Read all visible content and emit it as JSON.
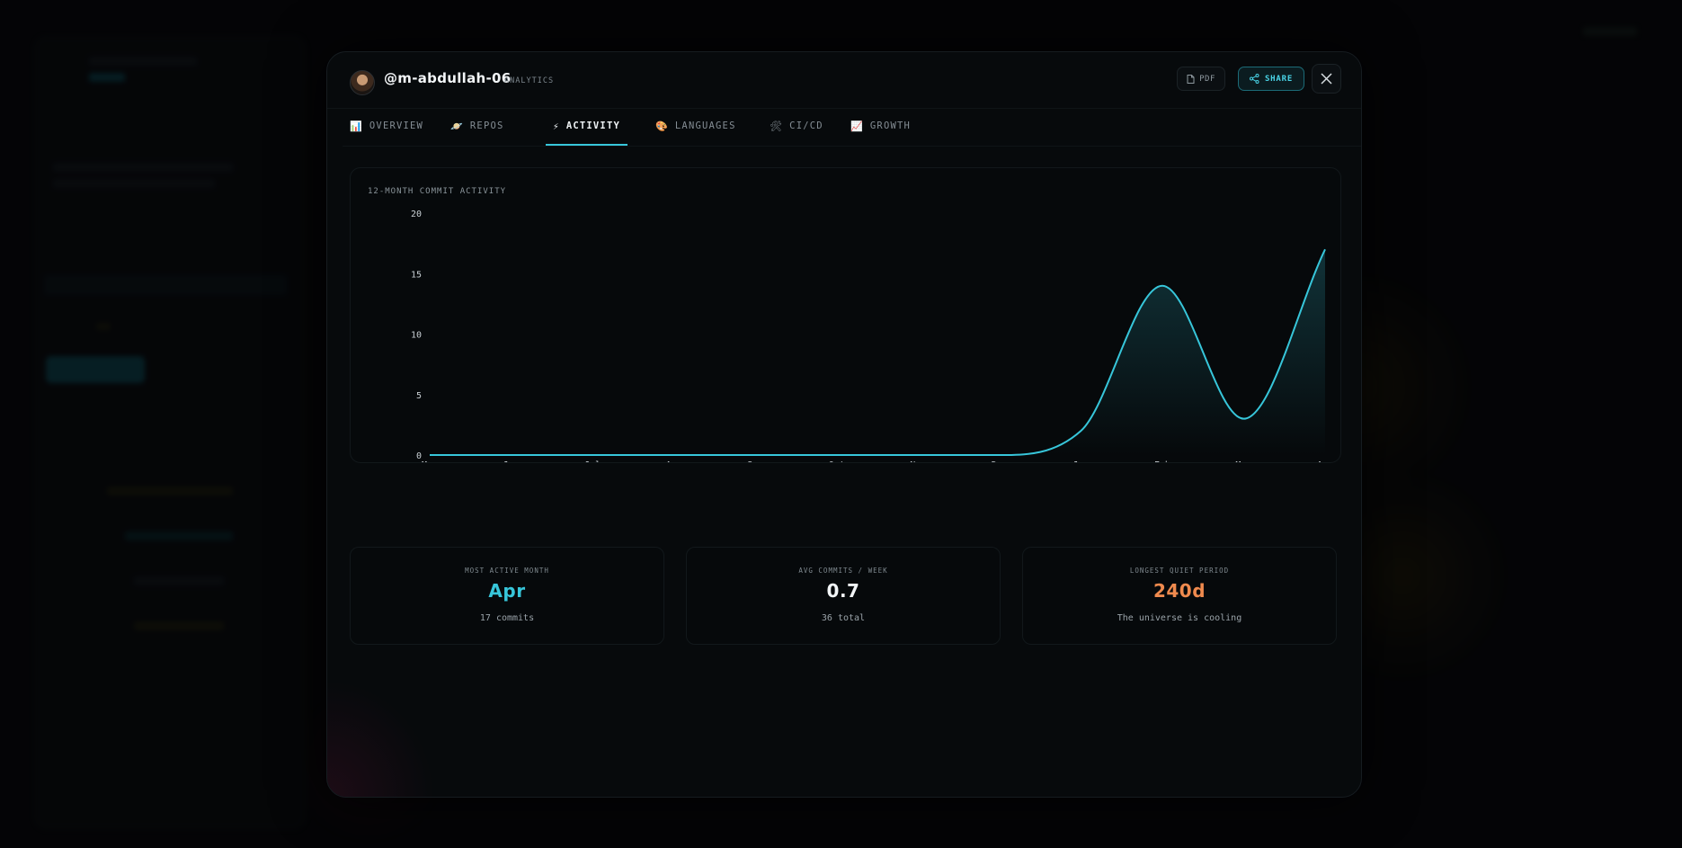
{
  "modal": {
    "username": "@m-abdullah-06",
    "subtitle": "ANALYTICS",
    "actions": {
      "pdf_label": "PDF",
      "share_label": "SHARE"
    }
  },
  "tabs": [
    {
      "label": "OVERVIEW",
      "icon": "📊"
    },
    {
      "label": "REPOS",
      "icon": "🪐"
    },
    {
      "label": "ACTIVITY",
      "icon": "⚡"
    },
    {
      "label": "LANGUAGES",
      "icon": "🎨"
    },
    {
      "label": "CI/CD",
      "icon": "🛠"
    },
    {
      "label": "GROWTH",
      "icon": "📈"
    }
  ],
  "active_tab": "ACTIVITY",
  "colors": {
    "accent": "#37c6da",
    "stat_blue": "#37c6da",
    "stat_white": "#f2f5f7",
    "stat_orange": "#ef8a4e"
  },
  "chart_data": {
    "type": "area",
    "title": "12-MONTH COMMIT ACTIVITY",
    "categories": [
      "May",
      "Jun",
      "Jul",
      "Aug",
      "Sep",
      "Oct",
      "Nov",
      "Dec",
      "Jan",
      "Feb",
      "Mar",
      "Apr"
    ],
    "series": [
      {
        "name": "m-abdullah-06",
        "values": [
          0,
          0,
          0,
          0,
          0,
          0,
          0,
          0,
          2,
          14,
          3,
          17
        ]
      }
    ],
    "yticks": [
      0,
      5,
      10,
      15,
      20
    ],
    "ylim": [
      0,
      20
    ],
    "legend_position": "bottom",
    "grid": false
  },
  "stats": [
    {
      "label": "MOST ACTIVE MONTH",
      "value": "Apr",
      "sub": "17 commits"
    },
    {
      "label": "AVG COMMITS / WEEK",
      "value": "0.7",
      "sub": "36 total"
    },
    {
      "label": "LONGEST QUIET PERIOD",
      "value": "240d",
      "sub": "The universe is cooling"
    }
  ]
}
